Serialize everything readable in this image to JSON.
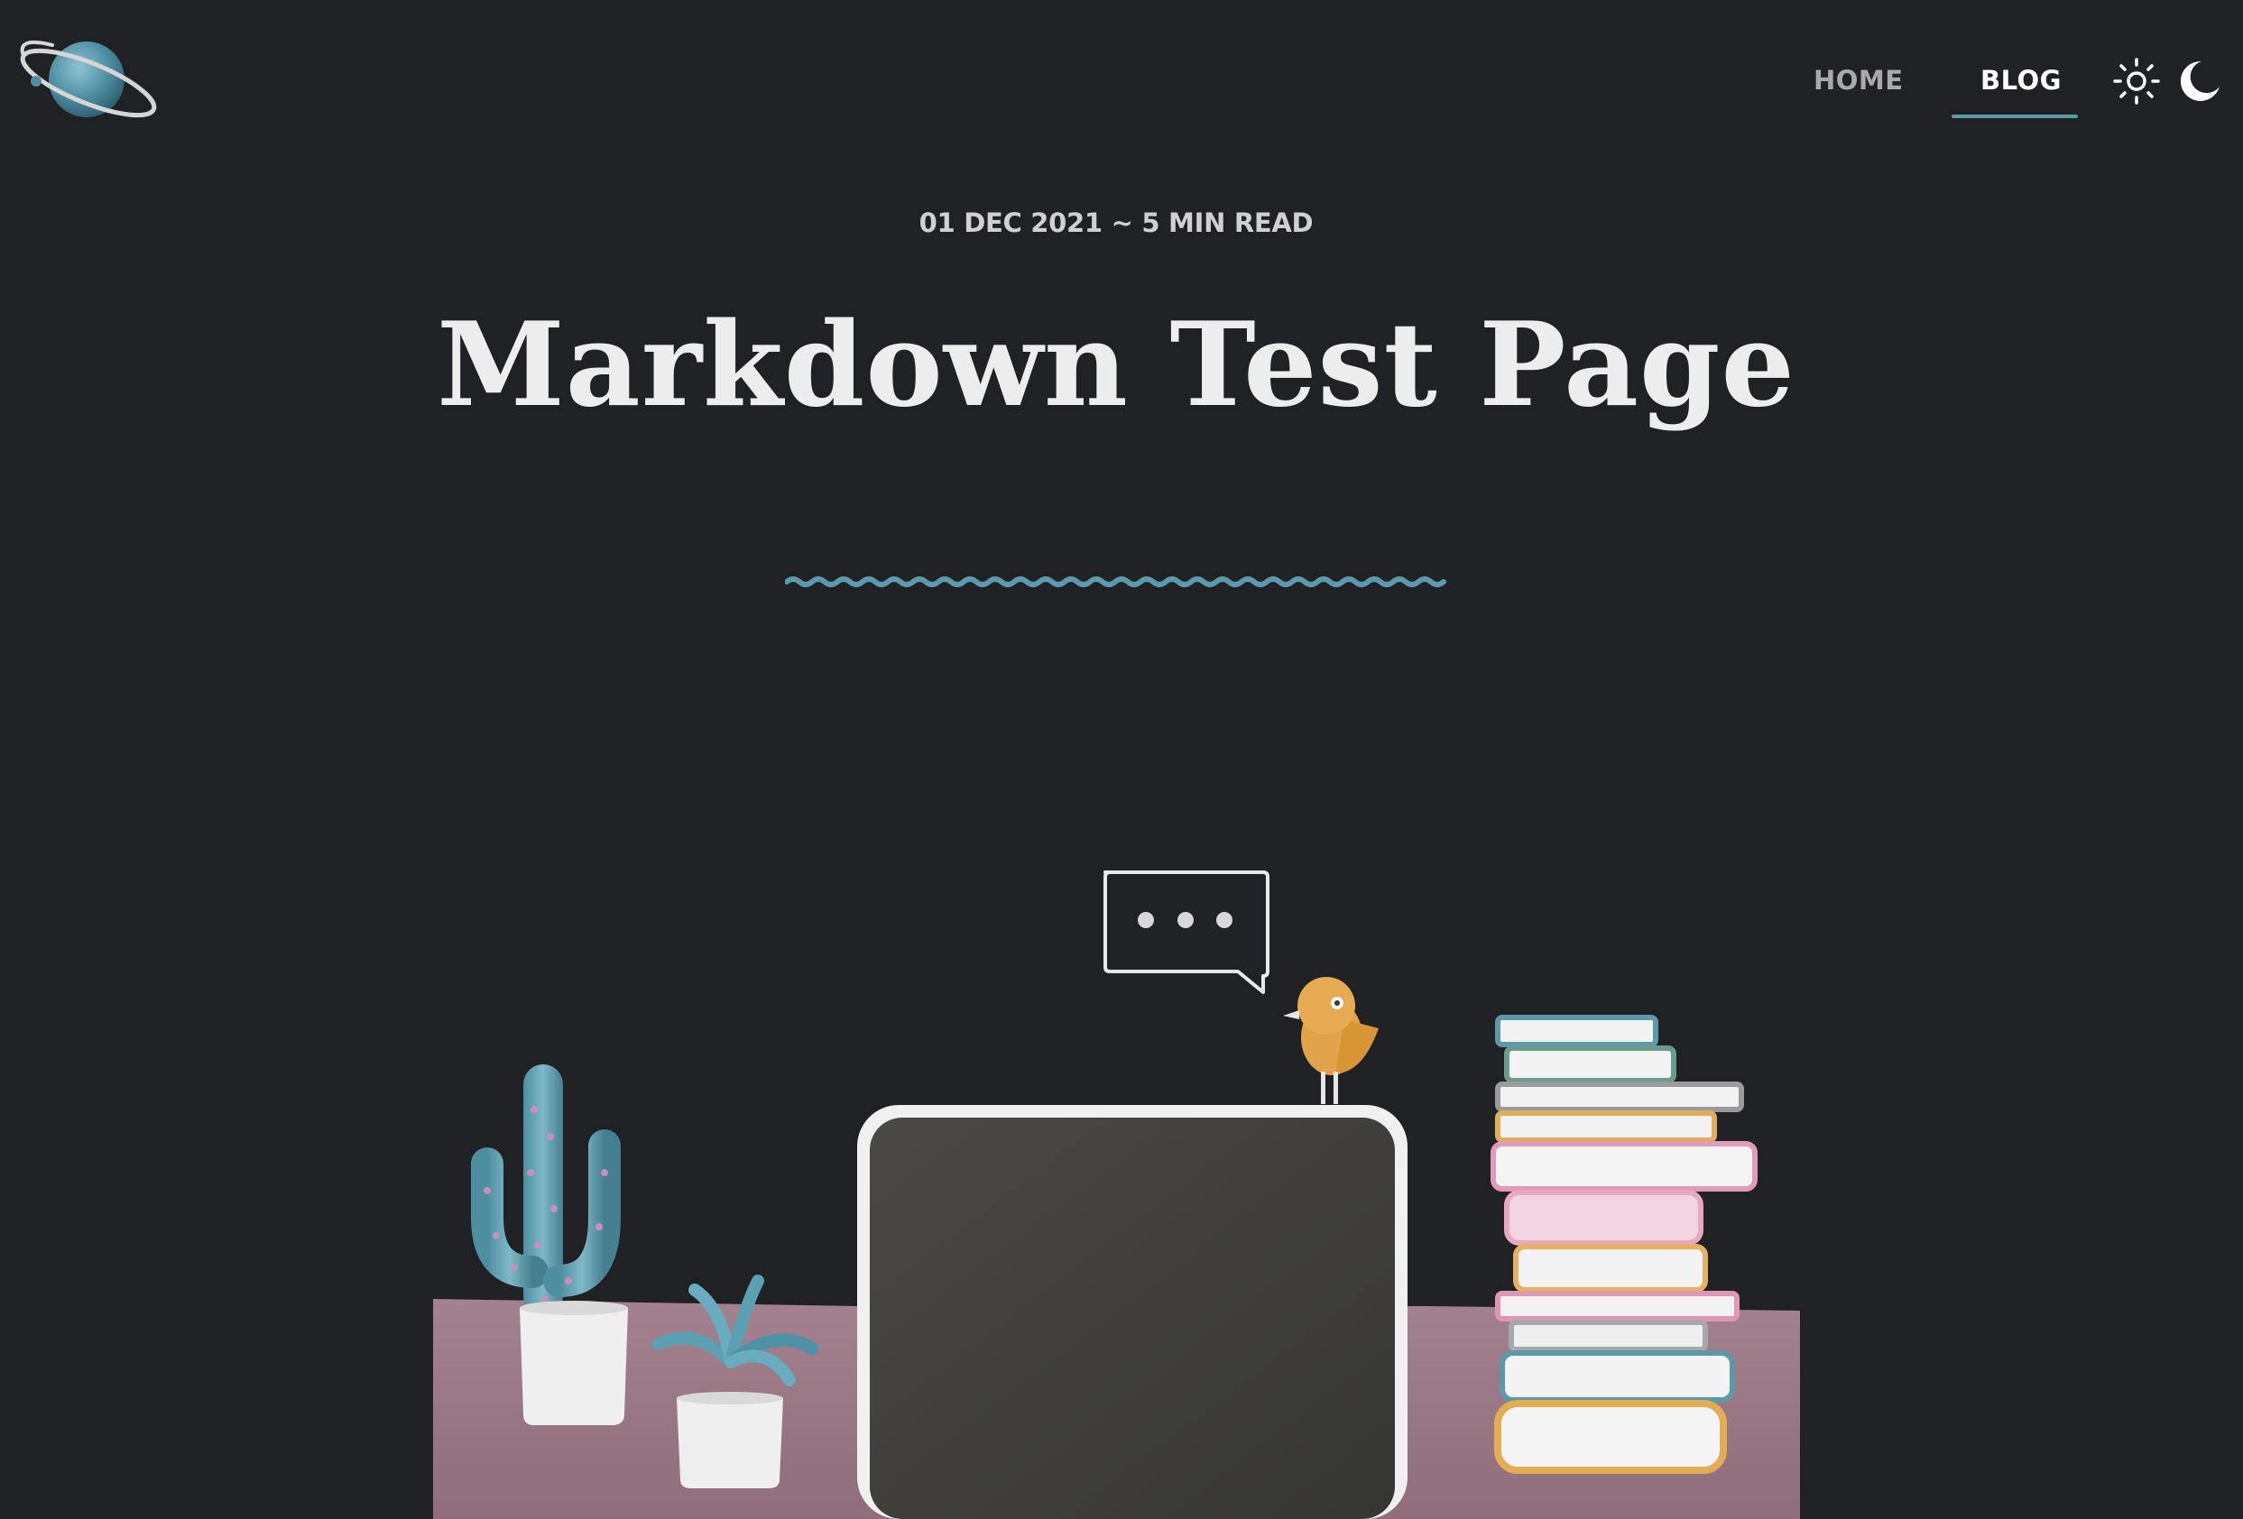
{
  "site": {
    "logo_icon": "planet-logo-icon"
  },
  "nav": {
    "items": [
      {
        "label": "HOME",
        "active": false
      },
      {
        "label": "BLOG",
        "active": true
      }
    ],
    "theme_light_icon": "sun-icon",
    "theme_dark_icon": "moon-icon"
  },
  "post": {
    "meta": "01 DEC 2021 ~ 5 MIN READ",
    "title": "Markdown Test Page",
    "divider_icon": "wavy-divider",
    "hero_image": "desk-scene-illustration"
  },
  "colors": {
    "background": "#202124",
    "accent": "#5a9aad",
    "title_text": "#ededed",
    "nav_inactive": "#a9a9ab"
  }
}
